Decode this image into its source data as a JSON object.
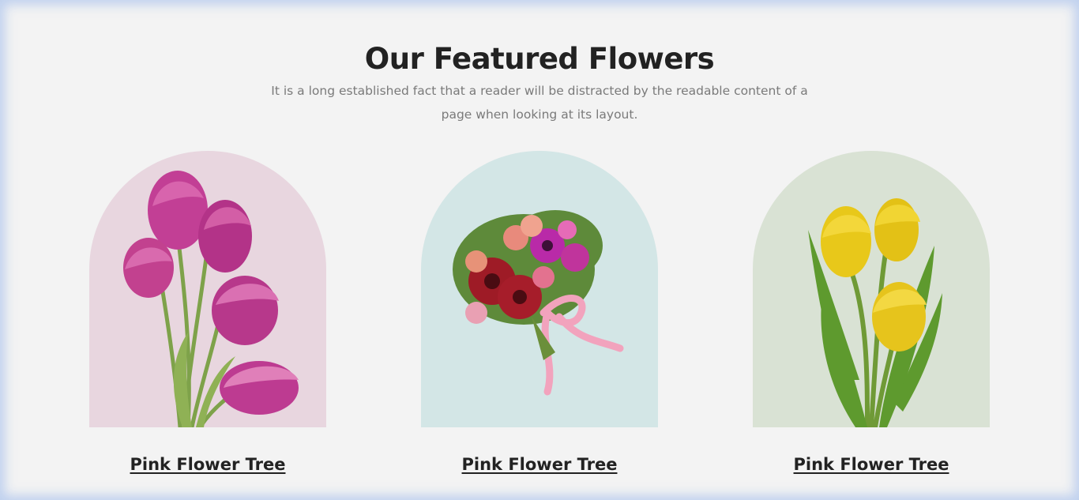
{
  "featured": {
    "title": "Our Featured Flowers",
    "description": "It is a long established fact that a reader will be distracted by the readable content of a page when looking at its layout."
  },
  "colors": {
    "page_background": "#f3f3f3",
    "title_color": "#222222",
    "text_color": "#7a7a7a",
    "card_pink_bg": "#e8d6df",
    "card_blue_bg": "#d3e6e6",
    "card_green_bg": "#d9e2d4"
  },
  "cards": [
    {
      "title": "Pink Flower Tree",
      "image": "pink-tulips-image"
    },
    {
      "title": "Pink Flower Tree",
      "image": "flower-bouquet-image"
    },
    {
      "title": "Pink Flower Tree",
      "image": "yellow-tulips-image"
    }
  ]
}
